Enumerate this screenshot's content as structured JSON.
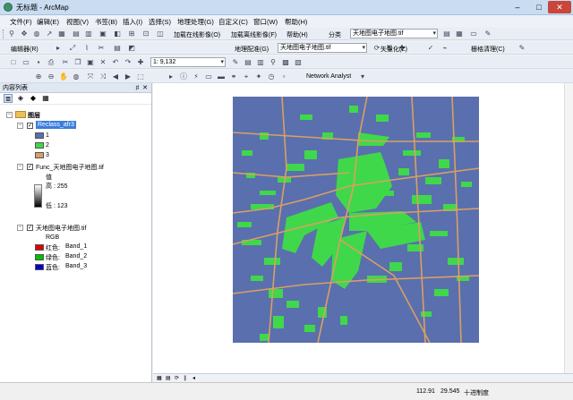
{
  "window": {
    "title": "无标题 - ArcMap",
    "min": "–",
    "max": "□",
    "close": "✕"
  },
  "menu": [
    "文件(F)",
    "编辑(E)",
    "视图(V)",
    "书签(B)",
    "插入(I)",
    "选择(S)",
    "地理处理(G)",
    "自定义(C)",
    "窗口(W)",
    "帮助(H)"
  ],
  "toolbar1": {
    "load_online": "加载在线影像(O)",
    "load_offline": "加载离线影像(F)",
    "help": "帮助(H)",
    "classify": "分类",
    "classify_layer": "天地图电子地图.tif"
  },
  "toolbar2": {
    "editor": "编辑器(R)",
    "georef": "地理配准(G)",
    "georef_layer": "天地图电子地图.tif",
    "vectorize": "矢量化(Z)",
    "raster_clean": "栅格清理(C)"
  },
  "toolbar3": {
    "scale": "1: 9,132"
  },
  "toolbar4": {
    "network_analyst": "Network Analyst"
  },
  "toc": {
    "title": "内容列表",
    "pin": "♯",
    "close": "✕",
    "root": "图层",
    "layer1": {
      "name": "Reclass_afr3",
      "classes": [
        {
          "label": "1",
          "color": "#5a6fae"
        },
        {
          "label": "2",
          "color": "#3fd84a"
        },
        {
          "label": "3",
          "color": "#d9a062"
        }
      ]
    },
    "layer2": {
      "name": "Func_天地图电子地图.tif",
      "field": "值",
      "high": "高 : 255",
      "low": "低 : 123"
    },
    "layer3": {
      "name": "天地图电子地图.tif",
      "mode": "RGB",
      "bands": [
        {
          "label": "红色:",
          "band": "Band_1",
          "color": "#e00000"
        },
        {
          "label": "绿色:",
          "band": "Band_2",
          "color": "#00c000"
        },
        {
          "label": "蓝色:",
          "band": "Band_3",
          "color": "#0000d0"
        }
      ]
    }
  },
  "map": {
    "background": "#5a6fae",
    "built": "#3fd84a",
    "road": "#d9a062"
  },
  "status": {
    "x": "112.91",
    "y": "29.545",
    "units": "十进制度"
  }
}
